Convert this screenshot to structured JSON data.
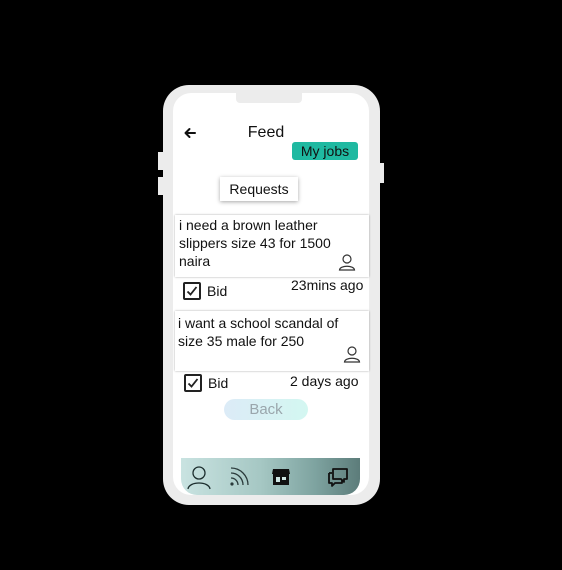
{
  "header": {
    "title": "Feed",
    "my_jobs_label": "My jobs"
  },
  "tabs": {
    "requests_label": "Requests"
  },
  "requests": [
    {
      "text_lines": [
        "i need a brown leather",
        "slippers size 43 for 1500",
        "naira"
      ],
      "bid_label": "Bid",
      "bid_checked": true,
      "time": "23mins ago"
    },
    {
      "text_lines": [
        "i want a school scandal of",
        "size 35 male for 250"
      ],
      "bid_label": "Bid",
      "bid_checked": true,
      "time": "2 days ago"
    }
  ],
  "footer": {
    "back_label": "Back"
  },
  "bottom_nav": {
    "items": [
      "profile-icon",
      "feed-icon",
      "store-icon",
      "chat-icon"
    ]
  },
  "colors": {
    "accent": "#1fb9a1",
    "background": "#000000",
    "phone_frame": "#ececec"
  }
}
